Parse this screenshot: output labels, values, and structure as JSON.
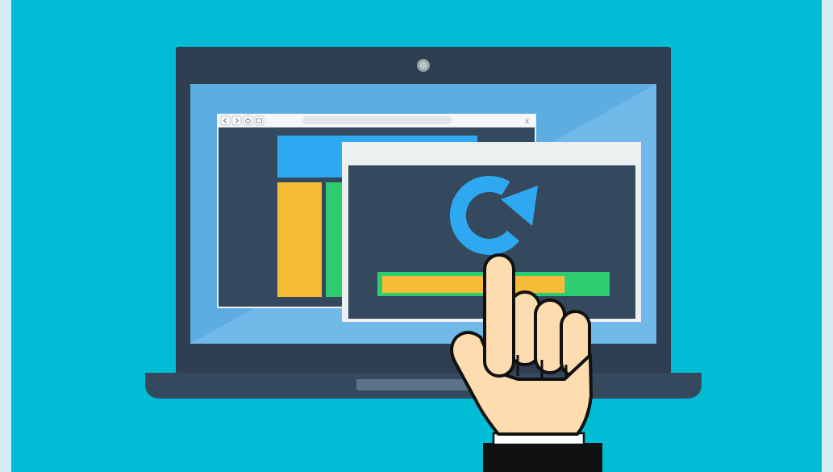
{
  "illustration": {
    "subject": "laptop-with-browser-refresh-and-pointing-hand",
    "colors": {
      "page_border": "#d6ecf3",
      "background": "#00bcd4",
      "laptop_body": "#2f3e50",
      "laptop_base": "#34495e",
      "screen": "#5dade2",
      "window_dark": "#34495e",
      "window_chrome": "#ecf0f1",
      "blue_block": "#2ea8f0",
      "yellow": "#f7bb36",
      "green": "#2ecc71",
      "refresh_icon": "#2ea8f0",
      "skin": "#fddcb0",
      "outline": "#111111",
      "sleeve": "#111111",
      "cuff": "#ffffff"
    },
    "back_window": {
      "nav_icons": [
        "back-icon",
        "forward-icon",
        "power-icon",
        "tabs-icon"
      ],
      "close_glyph": "x"
    },
    "front_window": {
      "icon": "refresh-icon",
      "progress_fraction": 0.82
    }
  }
}
